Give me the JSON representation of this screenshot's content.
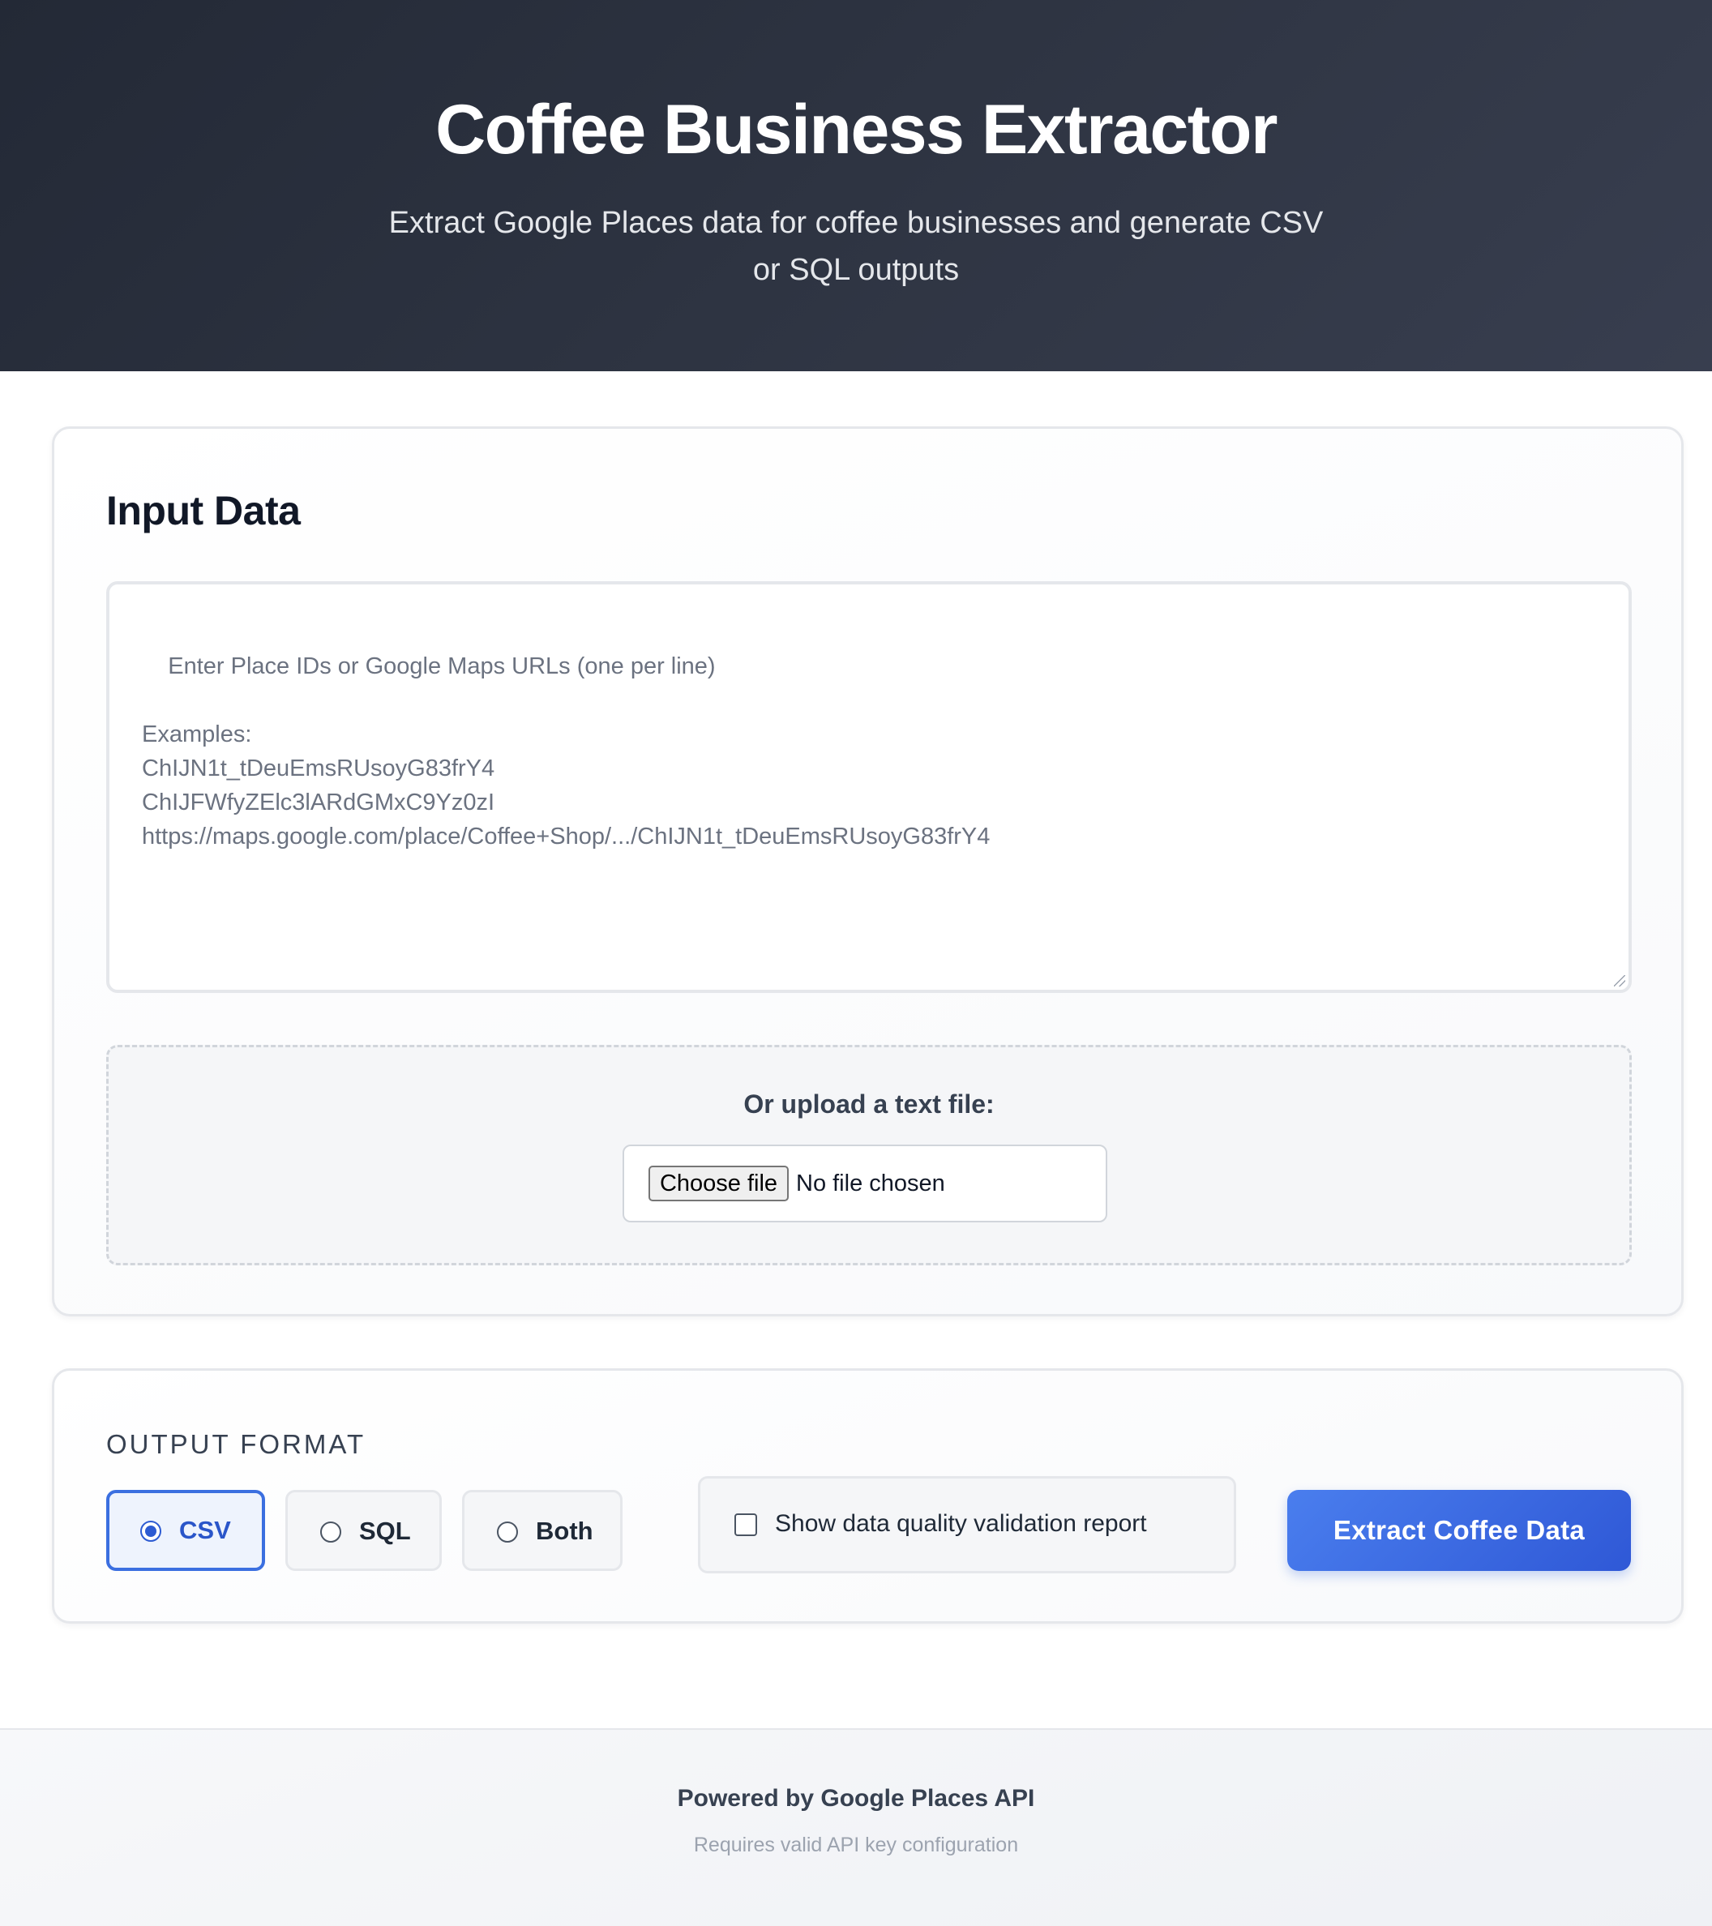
{
  "header": {
    "title": "Coffee Business Extractor",
    "subtitle": "Extract Google Places data for coffee businesses and generate CSV or SQL outputs"
  },
  "input_section": {
    "title": "Input Data",
    "textarea_placeholder": "Enter Place IDs or Google Maps URLs (one per line)\n\nExamples:\nChIJN1t_tDeuEmsRUsoyG83frY4\nChIJFWfyZElc3lARdGMxC9Yz0zI\nhttps://maps.google.com/place/Coffee+Shop/.../ChIJN1t_tDeuEmsRUsoyG83frY4",
    "textarea_value": "",
    "upload_label": "Or upload a text file:",
    "choose_file_label": "Choose file",
    "file_status": "No file chosen"
  },
  "output_section": {
    "label": "OUTPUT FORMAT",
    "options": [
      {
        "label": "CSV",
        "selected": true
      },
      {
        "label": "SQL",
        "selected": false
      },
      {
        "label": "Both",
        "selected": false
      }
    ],
    "validation_checkbox": {
      "label": "Show data quality validation report",
      "checked": false
    },
    "extract_button": "Extract Coffee Data"
  },
  "footer": {
    "title": "Powered by Google Places API",
    "subtitle": "Requires valid API key configuration"
  },
  "colors": {
    "header_bg": "#2e3442",
    "accent": "#3b6fe0",
    "button_gradient_start": "#4a7eee",
    "button_gradient_end": "#2f58d6"
  }
}
